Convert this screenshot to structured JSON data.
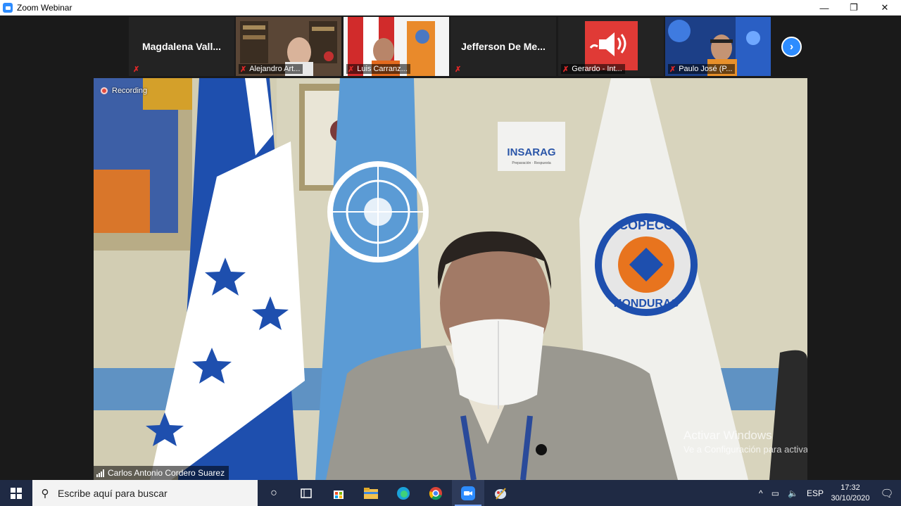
{
  "window": {
    "title": "Zoom Webinar",
    "minimize": "—",
    "restore": "❐",
    "close": "✕"
  },
  "gallery": {
    "tiles": [
      {
        "name_center": "Magdalena  Vall...",
        "label": ""
      },
      {
        "name_center": "",
        "label": "Alejandro Art..."
      },
      {
        "name_center": "",
        "label": "Luis Carranz..."
      },
      {
        "name_center": "Jefferson  De  Me...",
        "label": ""
      },
      {
        "name_center": "",
        "label": "Gerardo - Int..."
      },
      {
        "name_center": "",
        "label": "Paulo José (P..."
      }
    ],
    "next_button": "›"
  },
  "main": {
    "recording": "Recording",
    "speaker": "Carlos Antonio Cordero Suarez",
    "wall_sign": "INSARAG",
    "wall_sign_sub": "Preparación · Respuesta",
    "logo_top": "COPECO",
    "logo_bottom": "HONDURAS",
    "watermark_title": "Activar Windows",
    "watermark_text": "Ve a Configuración para activar Windows."
  },
  "taskbar": {
    "search_placeholder": "Escribe aquí para buscar",
    "language": "ESP",
    "time": "17:32",
    "date": "30/10/2020"
  },
  "colors": {
    "zoom_blue": "#2d8cff",
    "honduras_blue": "#1e4fae",
    "un_blue": "#5b9bd5",
    "copeco_orange": "#e8741e"
  }
}
